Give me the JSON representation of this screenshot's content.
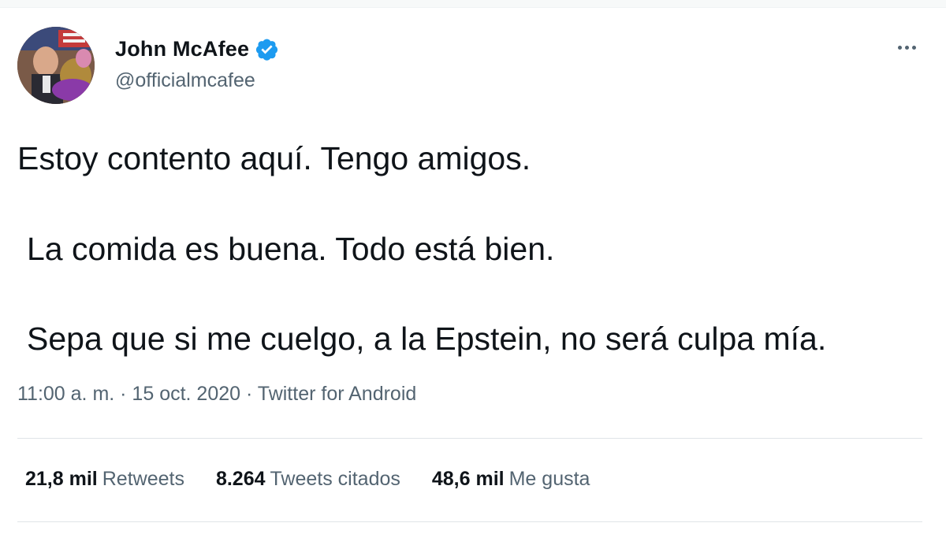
{
  "author": {
    "display_name": "John McAfee",
    "handle": "@officialmcafee",
    "verified": true
  },
  "icons": {
    "avatar": "profile-photo",
    "verified": "verified-badge-icon",
    "more": "more-options-icon"
  },
  "tweet": {
    "lines": [
      "Estoy contento aquí. Tengo amigos.",
      "La comida es buena. Todo está bien.",
      "Sepa que si me cuelgo, a la Epstein, no será culpa mía."
    ],
    "meta": "11:00 a. m. · 15 oct. 2020 · Twitter for Android"
  },
  "stats": {
    "retweets": {
      "count": "21,8 mil",
      "label": "Retweets"
    },
    "quotes": {
      "count": "8.264",
      "label": "Tweets citados"
    },
    "likes": {
      "count": "48,6 mil",
      "label": "Me gusta"
    }
  },
  "colors": {
    "text": "#0f1419",
    "secondary": "#536471",
    "verified_blue": "#1d9bf0",
    "divider": "#dfe4e7"
  }
}
